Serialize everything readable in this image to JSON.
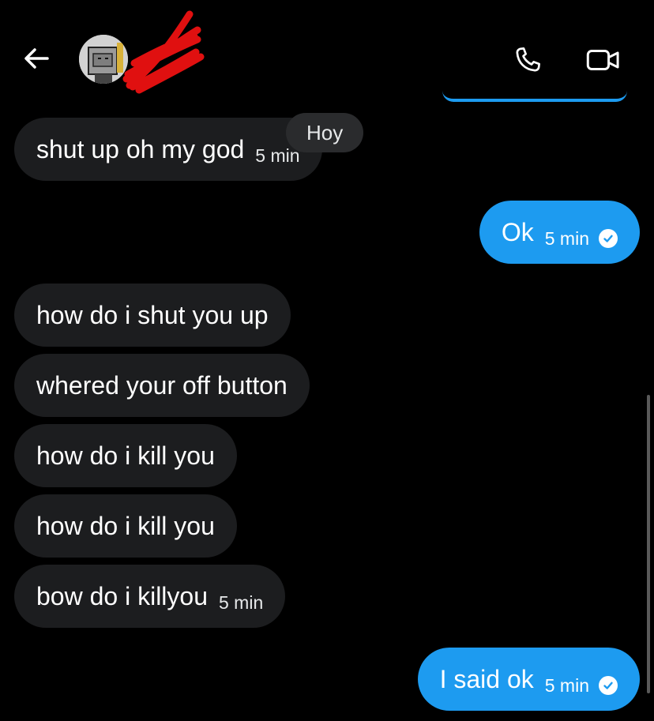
{
  "header": {
    "back_icon": "arrow-left-icon",
    "avatar_icon": "user-avatar",
    "call_icon": "phone-icon",
    "video_icon": "video-camera-icon"
  },
  "date_chip": "Hoy",
  "messages": [
    {
      "direction": "in",
      "text": "shut up oh my god",
      "time": "5 min"
    },
    {
      "direction": "out",
      "text": "Ok",
      "time": "5 min",
      "read": true
    },
    {
      "direction": "in",
      "text": "how do i shut you up",
      "time": ""
    },
    {
      "direction": "in",
      "text": "whered your off button",
      "time": ""
    },
    {
      "direction": "in",
      "text": "how do i kill you",
      "time": ""
    },
    {
      "direction": "in",
      "text": "how do i kill you",
      "time": ""
    },
    {
      "direction": "in",
      "text": "bow do i killyou",
      "time": "5 min"
    },
    {
      "direction": "out",
      "text": "I said ok",
      "time": "5 min",
      "read": true
    }
  ],
  "colors": {
    "background": "#000000",
    "incoming_bubble": "#1c1d1f",
    "outgoing_bubble": "#1d9bf0",
    "scribble": "#e01010"
  }
}
